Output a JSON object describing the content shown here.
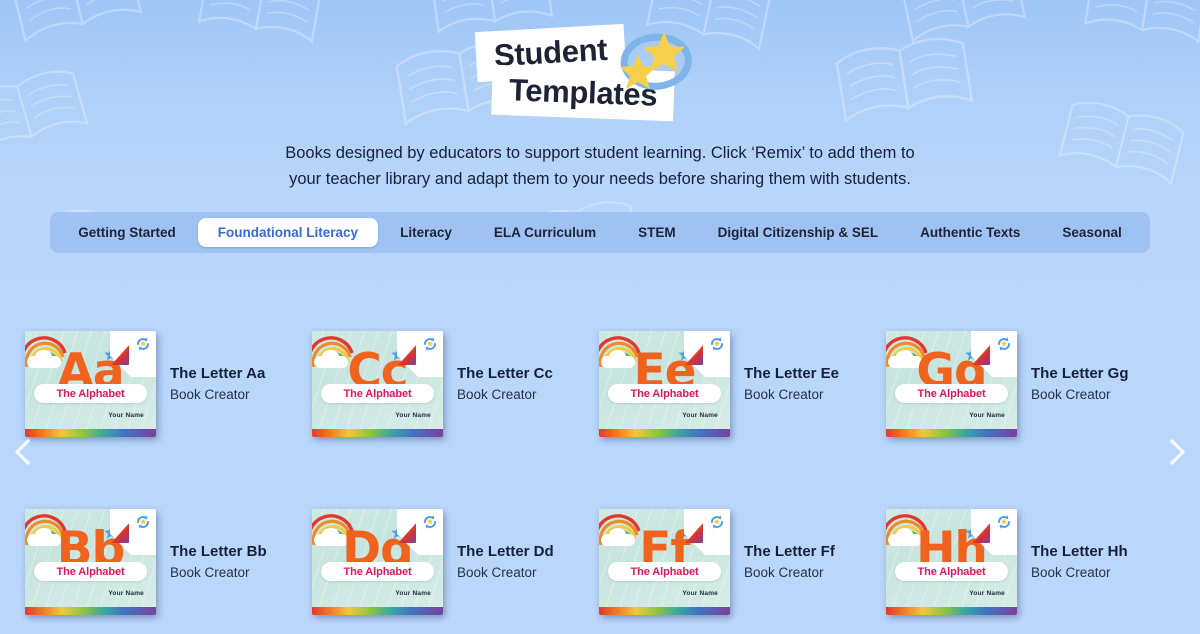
{
  "header": {
    "title_line_1": "Student",
    "title_line_2": "Templates",
    "sparkle_icon": "stars-swoosh-icon",
    "subtitle_line_1": "Books designed by educators to support student learning. Click ‘Remix’ to add them to",
    "subtitle_line_2": "your teacher library and adapt them to your needs before sharing them with students."
  },
  "tabs": [
    {
      "label": "Getting Started",
      "active": false
    },
    {
      "label": "Foundational Literacy",
      "active": true
    },
    {
      "label": "Literacy",
      "active": false
    },
    {
      "label": "ELA Curriculum",
      "active": false
    },
    {
      "label": "STEM",
      "active": false
    },
    {
      "label": "Digital Citizenship & SEL",
      "active": false
    },
    {
      "label": "Authentic Texts",
      "active": false
    },
    {
      "label": "Seasonal",
      "active": false
    }
  ],
  "carousel": {
    "prev_label": "‹",
    "next_label": "›",
    "prev_icon": "chevron-left-icon",
    "next_icon": "chevron-right-icon",
    "rows": [
      {
        "cards": [
          {
            "letter": "Aa",
            "title": "The Letter Aa",
            "author": "Book Creator",
            "cover_pill": "The Alphabet",
            "cover_byline": "Your Name"
          },
          {
            "letter": "Cc",
            "title": "The Letter Cc",
            "author": "Book Creator",
            "cover_pill": "The Alphabet",
            "cover_byline": "Your Name"
          },
          {
            "letter": "Ee",
            "title": "The Letter Ee",
            "author": "Book Creator",
            "cover_pill": "The Alphabet",
            "cover_byline": "Your Name"
          },
          {
            "letter": "Gg",
            "title": "The Letter Gg",
            "author": "Book Creator",
            "cover_pill": "The Alphabet",
            "cover_byline": "Your Name"
          }
        ]
      },
      {
        "cards": [
          {
            "letter": "Bb",
            "title": "The Letter Bb",
            "author": "Book Creator",
            "cover_pill": "The Alphabet",
            "cover_byline": "Your Name"
          },
          {
            "letter": "Dd",
            "title": "The Letter Dd",
            "author": "Book Creator",
            "cover_pill": "The Alphabet",
            "cover_byline": "Your Name"
          },
          {
            "letter": "Ff",
            "title": "The Letter Ff",
            "author": "Book Creator",
            "cover_pill": "The Alphabet",
            "cover_byline": "Your Name"
          },
          {
            "letter": "Hh",
            "title": "The Letter Hh",
            "author": "Book Creator",
            "cover_pill": "The Alphabet",
            "cover_byline": "Your Name"
          }
        ]
      }
    ]
  },
  "colors": {
    "page_background": "#b8d5fb",
    "page_background_top": "#9ec5f5",
    "tabbar_background": "#9fc2f2",
    "tab_active_background": "#ffffff",
    "tab_active_text": "#3a68d8",
    "tab_text": "#1b2438",
    "title_text": "#1b2334",
    "letter_orange": "#f0631f",
    "alphabet_pink": "#e0175d",
    "cover_teal": "#cfe9e3"
  }
}
